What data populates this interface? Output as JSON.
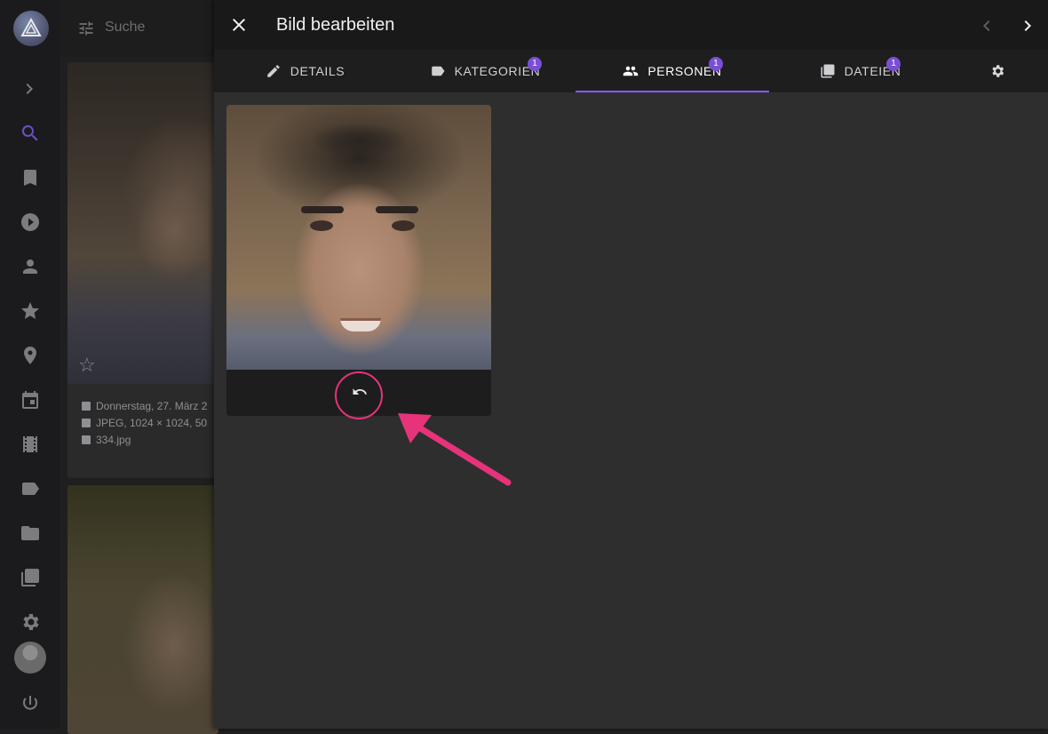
{
  "search": {
    "placeholder": "Suche"
  },
  "rail": {
    "items": [
      "expand-icon",
      "search-icon",
      "bookmark-icon",
      "play-icon",
      "person-icon",
      "star-icon",
      "location-icon",
      "calendar-icon",
      "film-icon",
      "label-icon",
      "folder-icon",
      "library-icon",
      "settings-icon",
      "avatar",
      "power-icon"
    ],
    "active": "search-icon"
  },
  "grid": {
    "card1": {
      "date": "Donnerstag, 27. März 2",
      "info": "JPEG, 1024 × 1024, 50",
      "file": "334.jpg"
    }
  },
  "dialog": {
    "title": "Bild bearbeiten",
    "tabs": [
      {
        "label": "DETAILS",
        "icon": "pencil-icon"
      },
      {
        "label": "KATEGORIEN",
        "icon": "label-icon",
        "badge": "1"
      },
      {
        "label": "PERSONEN",
        "icon": "people-icon",
        "badge": "1",
        "active": true
      },
      {
        "label": "DATEIEN",
        "icon": "files-icon",
        "badge": "1"
      }
    ],
    "settings_icon": "gear-icon"
  },
  "colors": {
    "accent": "#8a5cf6",
    "badge": "#7a4fd6",
    "highlight": "#e6337a"
  }
}
